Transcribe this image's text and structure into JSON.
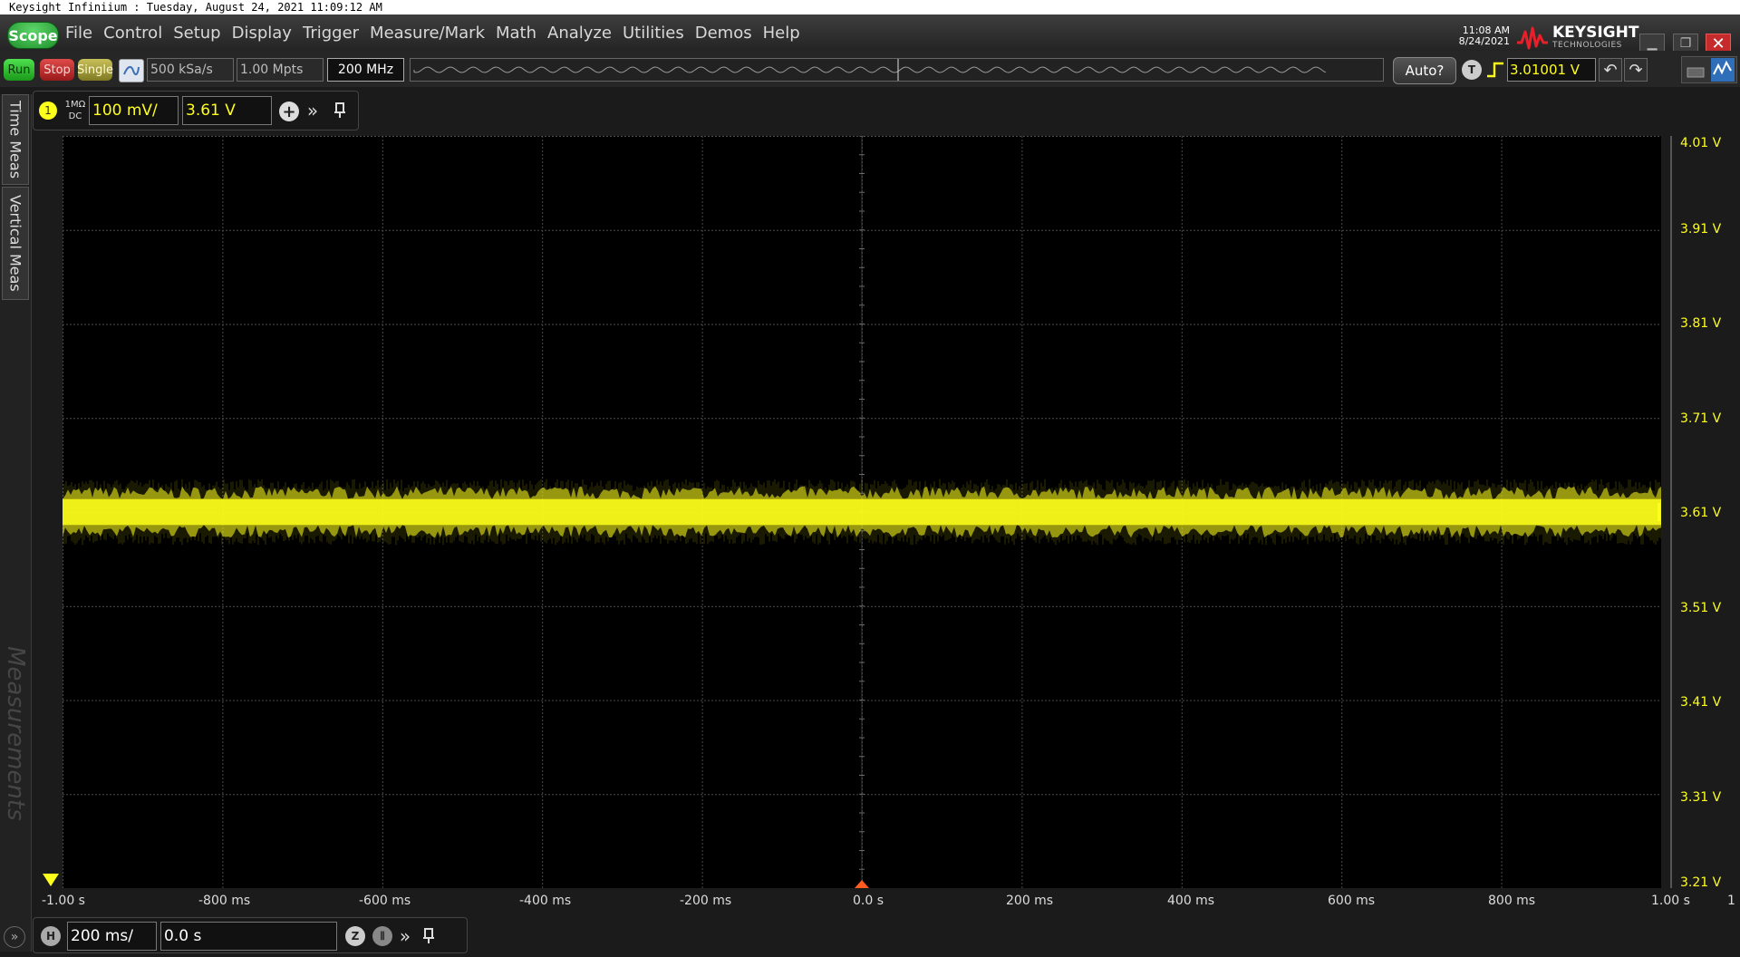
{
  "window": {
    "title": "Keysight Infiniium : Tuesday, August 24, 2021 11:09:12 AM"
  },
  "menubar": {
    "scope_label": "Scope",
    "items": [
      "File",
      "Control",
      "Setup",
      "Display",
      "Trigger",
      "Measure/Mark",
      "Math",
      "Analyze",
      "Utilities",
      "Demos",
      "Help"
    ],
    "clock_time": "11:08 AM",
    "clock_date": "8/24/2021",
    "brand_name": "KEYSIGHT",
    "brand_sub": "TECHNOLOGIES"
  },
  "toolbar": {
    "run_label": "Run",
    "stop_label": "Stop",
    "single_label": "Single",
    "sample_rate": "500 kSa/s",
    "memory_depth": "1.00 Mpts",
    "bandwidth": "200 MHz",
    "auto_label": "Auto?",
    "trigger_icon_label": "T",
    "trigger_level": "3.01001 V"
  },
  "side_tabs": {
    "time_meas": "Time Meas",
    "vertical_meas": "Vertical Meas",
    "measurements_watermark": "Measurements"
  },
  "channel": {
    "number": "1",
    "impedance": "1MΩ",
    "coupling": "DC",
    "scale": "100 mV/",
    "offset": "3.61 V"
  },
  "graticule": {
    "trace_color": "#ffff1c",
    "trace_level_v": 3.61,
    "trace_noise_band_v": 0.05,
    "trigger_marker_label": "T",
    "y_labels": [
      "4.01 V",
      "3.91 V",
      "3.81 V",
      "3.71 V",
      "3.61 V",
      "3.51 V",
      "3.41 V",
      "3.31 V",
      "3.21 V"
    ],
    "x_labels": [
      "-1.00 s",
      "-800 ms",
      "-600 ms",
      "-400 ms",
      "-200 ms",
      "0.0 s",
      "200 ms",
      "400 ms",
      "600 ms",
      "800 ms",
      "1.00 s"
    ],
    "x_right_label": "1"
  },
  "timebase": {
    "h_label": "H",
    "scale": "200 ms/",
    "position": "0.0 s",
    "zoom_label": "Z"
  }
}
